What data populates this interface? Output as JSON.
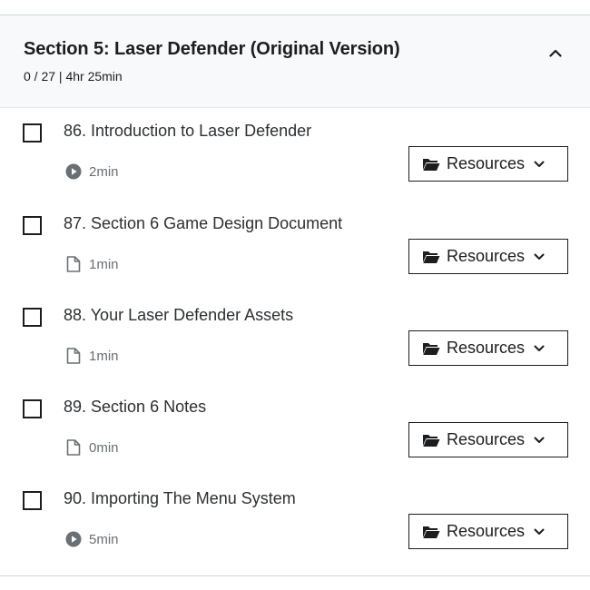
{
  "section": {
    "title": "Section 5: Laser Defender (Original Version)",
    "meta": "0 / 27 | 4hr 25min",
    "collapse_icon": "chevron-up-icon"
  },
  "resources_label": "Resources",
  "lectures": [
    {
      "title": "86. Introduction to Laser Defender",
      "duration": "2min",
      "type": "video",
      "icon": "play-circle-icon",
      "completed": false
    },
    {
      "title": "87. Section 6 Game Design Document",
      "duration": "1min",
      "type": "article",
      "icon": "file-icon",
      "completed": false
    },
    {
      "title": "88. Your Laser Defender Assets",
      "duration": "1min",
      "type": "article",
      "icon": "file-icon",
      "completed": false
    },
    {
      "title": "89. Section 6 Notes",
      "duration": "0min",
      "type": "article",
      "icon": "file-icon",
      "completed": false
    },
    {
      "title": "90. Importing The Menu System",
      "duration": "5min",
      "type": "video",
      "icon": "play-circle-icon",
      "completed": false
    }
  ]
}
